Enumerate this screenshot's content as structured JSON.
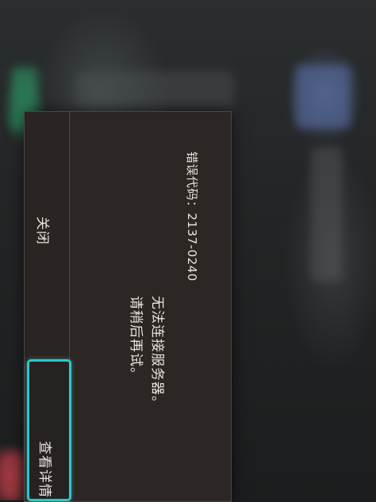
{
  "dialog": {
    "error_code": "错误代码：2137-0240",
    "message_line1": "无法连接服务器。",
    "message_line2": "请稍后再试。",
    "close_label": "关闭",
    "details_label": "查看详情"
  },
  "colors": {
    "dialog_bg": "#2c2624",
    "text": "#e9e4df",
    "focus_accent": "#2fc7c9"
  }
}
